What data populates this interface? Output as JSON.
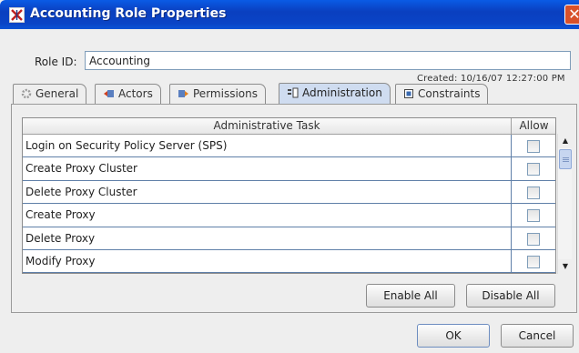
{
  "window": {
    "title": "Accounting Role Properties",
    "close_glyph": "✕"
  },
  "role": {
    "label": "Role ID:",
    "value": "Accounting",
    "created": "Created: 10/16/07 12:27:00 PM"
  },
  "tabs": [
    {
      "label": "General",
      "icon": "general-icon"
    },
    {
      "label": "Actors",
      "icon": "actors-icon"
    },
    {
      "label": "Permissions",
      "icon": "permissions-icon"
    },
    {
      "label": "Administration",
      "icon": "administration-icon",
      "active": true
    },
    {
      "label": "Constraints",
      "icon": "constraints-icon"
    }
  ],
  "table": {
    "headers": {
      "task": "Administrative Task",
      "allow": "Allow"
    },
    "rows": [
      {
        "task": "Login on Security Policy Server (SPS)",
        "allow": false
      },
      {
        "task": "Create Proxy Cluster",
        "allow": false
      },
      {
        "task": "Delete Proxy Cluster",
        "allow": false
      },
      {
        "task": "Create Proxy",
        "allow": false
      },
      {
        "task": "Delete Proxy",
        "allow": false
      },
      {
        "task": "Modify Proxy",
        "allow": false
      }
    ]
  },
  "buttons": {
    "enable_all": "Enable All",
    "disable_all": "Disable All",
    "ok": "OK",
    "cancel": "Cancel"
  },
  "colors": {
    "titlebar": "#0a44c6",
    "active_tab": "#cfdcf0",
    "close": "#d8512a"
  }
}
